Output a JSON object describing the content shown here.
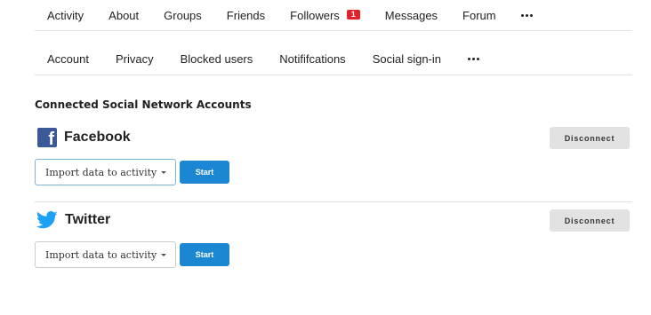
{
  "nav_primary": {
    "items": [
      {
        "label": "Activity"
      },
      {
        "label": "About"
      },
      {
        "label": "Groups"
      },
      {
        "label": "Friends"
      },
      {
        "label": "Followers",
        "badge": "1"
      },
      {
        "label": "Messages"
      },
      {
        "label": "Forum"
      }
    ],
    "more_icon": "ellipsis-icon"
  },
  "nav_secondary": {
    "items": [
      {
        "label": "Account"
      },
      {
        "label": "Privacy"
      },
      {
        "label": "Blocked users"
      },
      {
        "label": "Notififcations"
      },
      {
        "label": "Social sign-in"
      }
    ],
    "more_icon": "ellipsis-icon"
  },
  "section_title": "Connected Social Network Accounts",
  "accounts": [
    {
      "name": "Facebook",
      "icon": "facebook-icon",
      "icon_color": "#3b5998",
      "disconnect_label": "Disconnect",
      "select_value": "Import data to activity",
      "start_label": "Start"
    },
    {
      "name": "Twitter",
      "icon": "twitter-icon",
      "icon_color": "#1da1f2",
      "disconnect_label": "Disconnect",
      "select_value": "Import data to activity",
      "start_label": "Start"
    }
  ],
  "colors": {
    "badge": "#e3212b",
    "primary_button": "#1b87d2",
    "secondary_button": "#e2e2e2"
  }
}
